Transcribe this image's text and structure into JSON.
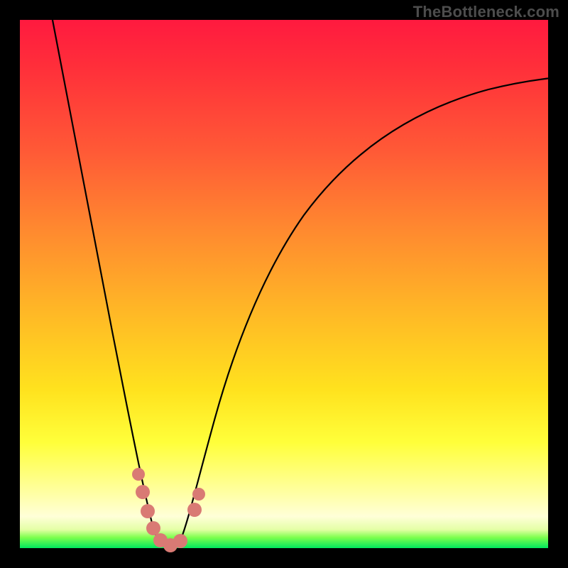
{
  "watermark": "TheBottleneck.com",
  "colors": {
    "frame": "#000000",
    "curve": "#000000",
    "marker": "#d97a74",
    "gradient_stops": [
      {
        "pos": 0.0,
        "color": "#ff1a3f"
      },
      {
        "pos": 0.09,
        "color": "#ff2f3a"
      },
      {
        "pos": 0.25,
        "color": "#ff5a36"
      },
      {
        "pos": 0.4,
        "color": "#ff8a2f"
      },
      {
        "pos": 0.55,
        "color": "#ffb726"
      },
      {
        "pos": 0.7,
        "color": "#ffe21e"
      },
      {
        "pos": 0.8,
        "color": "#ffff3a"
      },
      {
        "pos": 0.9,
        "color": "#ffffa8"
      },
      {
        "pos": 0.94,
        "color": "#ffffd8"
      },
      {
        "pos": 0.965,
        "color": "#e4ffa5"
      },
      {
        "pos": 0.98,
        "color": "#7cff4d"
      },
      {
        "pos": 1.0,
        "color": "#00e85e"
      }
    ]
  },
  "chart_data": {
    "type": "line",
    "title": "",
    "xlabel": "",
    "ylabel": "",
    "xlim": [
      0,
      100
    ],
    "ylim": [
      0,
      100
    ],
    "note": "V-shaped bottleneck curve. x is relative position across plot (0=left,100=right). y is bottleneck percentage (0=bottom/green/no bottleneck, 100=top/red/max bottleneck). Curve reaches minimum (~0) between x≈24 and x≈30.",
    "series": [
      {
        "name": "bottleneck-curve",
        "x": [
          6,
          8,
          10,
          12,
          14,
          16,
          18,
          20,
          22,
          24,
          26,
          28,
          30,
          33,
          36,
          40,
          45,
          50,
          55,
          60,
          65,
          70,
          75,
          80,
          85,
          90,
          95,
          100
        ],
        "y": [
          100,
          90,
          80,
          70,
          60,
          50,
          40,
          30,
          18,
          6,
          1,
          0,
          1,
          8,
          18,
          30,
          42,
          52,
          59,
          65,
          70,
          74,
          77,
          80,
          82,
          84,
          85,
          86
        ]
      }
    ],
    "markers": {
      "note": "Salmon dot markers clustered along the trough of the curve",
      "points": [
        {
          "x": 21.0,
          "y": 15.0
        },
        {
          "x": 22.0,
          "y": 10.0
        },
        {
          "x": 23.0,
          "y": 6.0
        },
        {
          "x": 24.0,
          "y": 3.0
        },
        {
          "x": 25.5,
          "y": 1.0
        },
        {
          "x": 27.5,
          "y": 0.5
        },
        {
          "x": 29.5,
          "y": 1.5
        },
        {
          "x": 32.0,
          "y": 7.0
        },
        {
          "x": 33.0,
          "y": 10.0
        }
      ]
    }
  }
}
